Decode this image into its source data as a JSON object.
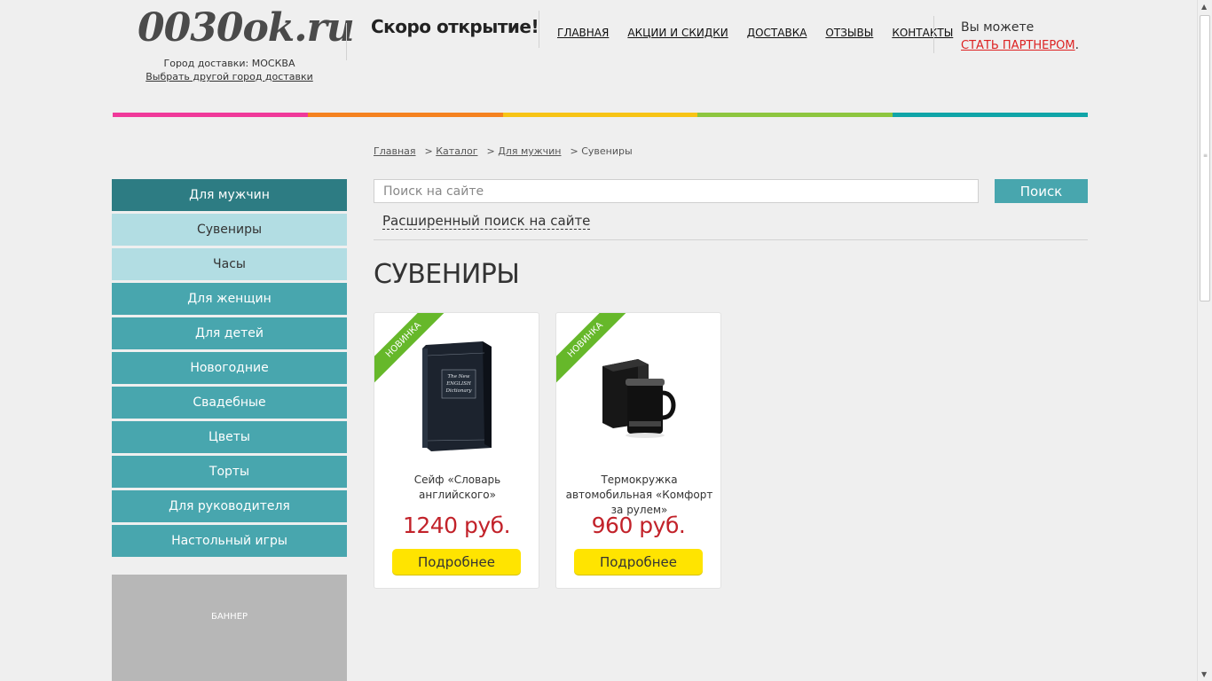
{
  "header": {
    "logo": "0030ok.ru",
    "city_label": "Город доставки: МОСКВА",
    "change_city": "Выбрать другой город доставки",
    "opening": "Скоро открытие!",
    "nav": [
      "ГЛАВНАЯ",
      "АКЦИИ И СКИДКИ",
      "ДОСТАВКА",
      "ОТЗЫВЫ",
      "КОНТАКТЫ"
    ],
    "partner_text": "Вы можете",
    "partner_link": "СТАТЬ ПАРТНЕРОМ"
  },
  "colors": {
    "stripes": [
      "#f0399a",
      "#f58220",
      "#f7c416",
      "#8dc63f",
      "#10a5a8"
    ],
    "accent": "#48a6ae",
    "price": "#c2222a",
    "button": "#ffe400",
    "ribbon": "#66b82a"
  },
  "breadcrumb": [
    "Главная",
    "Каталог",
    "Для мужчин",
    "Сувениры"
  ],
  "sidebar": {
    "items": [
      {
        "label": "Для мужчин",
        "state": "active"
      },
      {
        "label": "Сувениры",
        "state": "sub"
      },
      {
        "label": "Часы",
        "state": "sub"
      },
      {
        "label": "Для женщин",
        "state": "normal"
      },
      {
        "label": "Для детей",
        "state": "normal"
      },
      {
        "label": "Новогодние",
        "state": "normal"
      },
      {
        "label": "Свадебные",
        "state": "normal"
      },
      {
        "label": "Цветы",
        "state": "normal"
      },
      {
        "label": "Торты",
        "state": "normal"
      },
      {
        "label": "Для руководителя",
        "state": "normal"
      },
      {
        "label": "Настольный игры",
        "state": "normal"
      }
    ],
    "banner": "БАННЕР"
  },
  "search": {
    "placeholder": "Поиск на сайте",
    "button": "Поиск",
    "advanced": "Расширенный поиск на сайте"
  },
  "page_title": "СУВЕНИРЫ",
  "products": [
    {
      "badge": "НОВИНКА",
      "name": "Сейф «Словарь английского»",
      "price": "1240 руб.",
      "button": "Подробнее",
      "image": "book-safe-image",
      "book_title": "The New ENGLISH Dictionary"
    },
    {
      "badge": "НОВИНКА",
      "name": "Термокружка автомобильная «Комфорт за рулем»",
      "price": "960 руб.",
      "button": "Подробнее",
      "image": "thermo-mug-image"
    }
  ]
}
